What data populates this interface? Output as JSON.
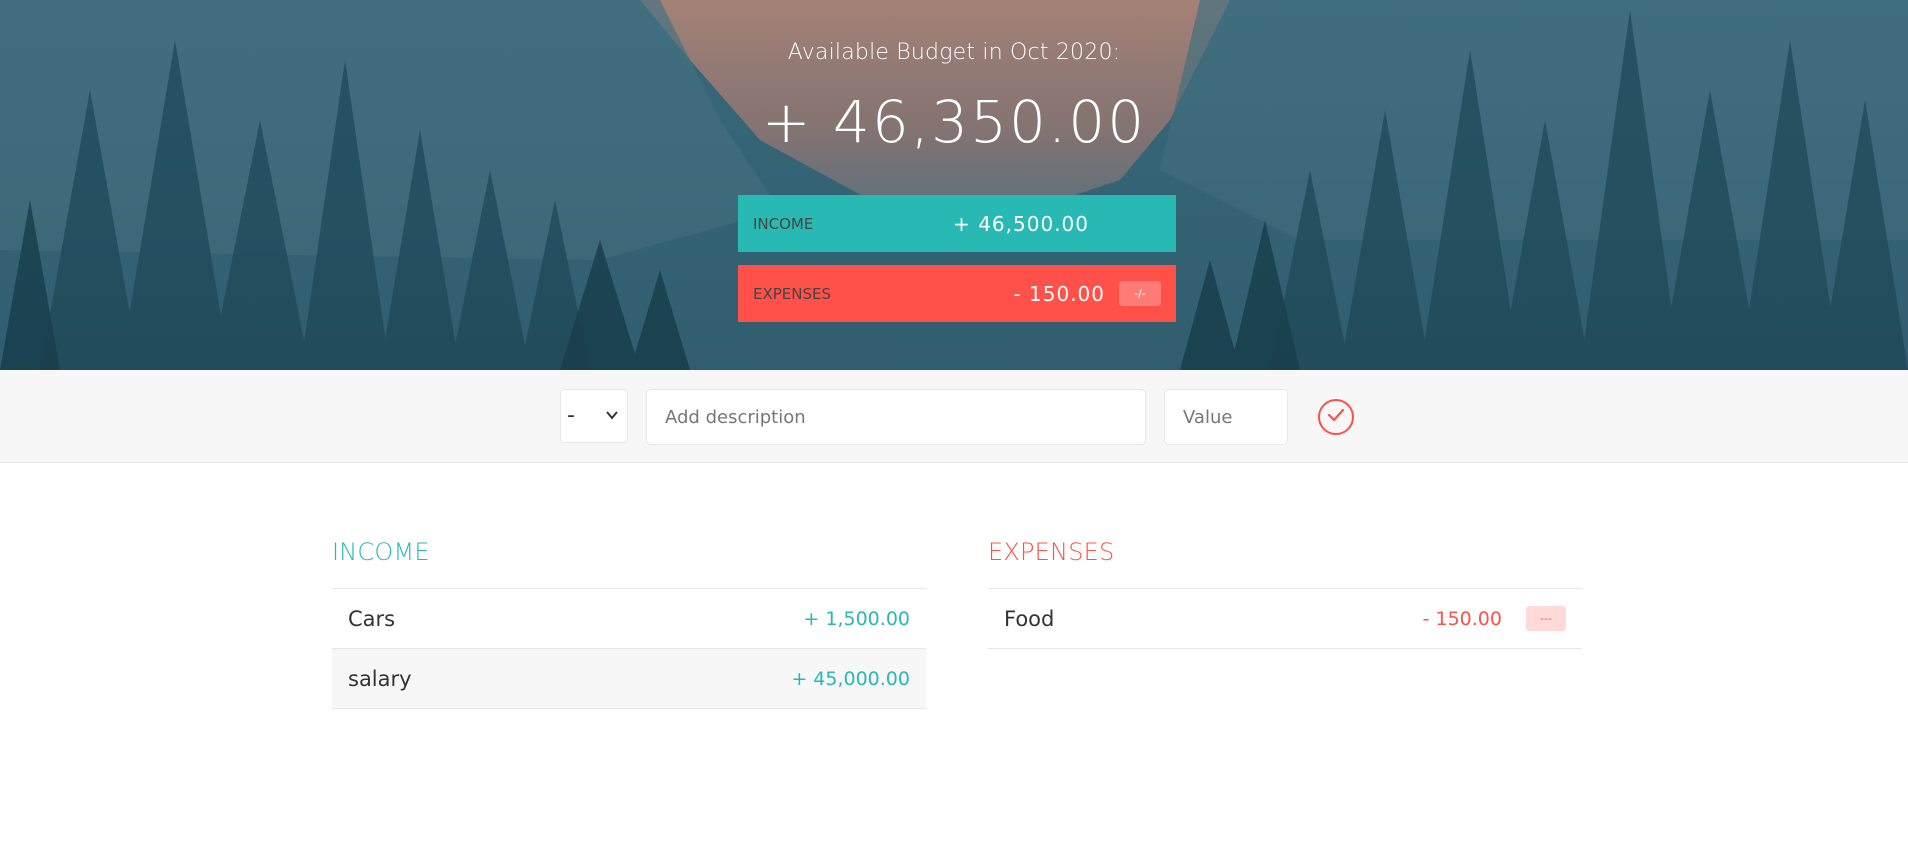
{
  "header": {
    "title": "Available Budget in Oct 2020:",
    "budget_value": "+ 46,350.00",
    "income": {
      "label": "INCOME",
      "value": "+ 46,500.00"
    },
    "expenses": {
      "label": "EXPENSES",
      "value": "- 150.00",
      "percentage": "-/-"
    }
  },
  "add_form": {
    "type_selected": "-",
    "description_placeholder": "Add description",
    "value_placeholder": "Value"
  },
  "income_list": {
    "title": "INCOME",
    "items": [
      {
        "description": "Cars",
        "value": "+ 1,500.00"
      },
      {
        "description": "salary",
        "value": "+ 45,000.00"
      }
    ]
  },
  "expenses_list": {
    "title": "EXPENSES",
    "items": [
      {
        "description": "Food",
        "value": "- 150.00",
        "percentage": "---"
      }
    ]
  },
  "colors": {
    "income": "#28b9b5",
    "expenses": "#ff5049",
    "background": "#f7f7f7"
  },
  "icons": {
    "add_button": "checkmark-circle-icon",
    "type_select": "chevron-down-icon"
  }
}
